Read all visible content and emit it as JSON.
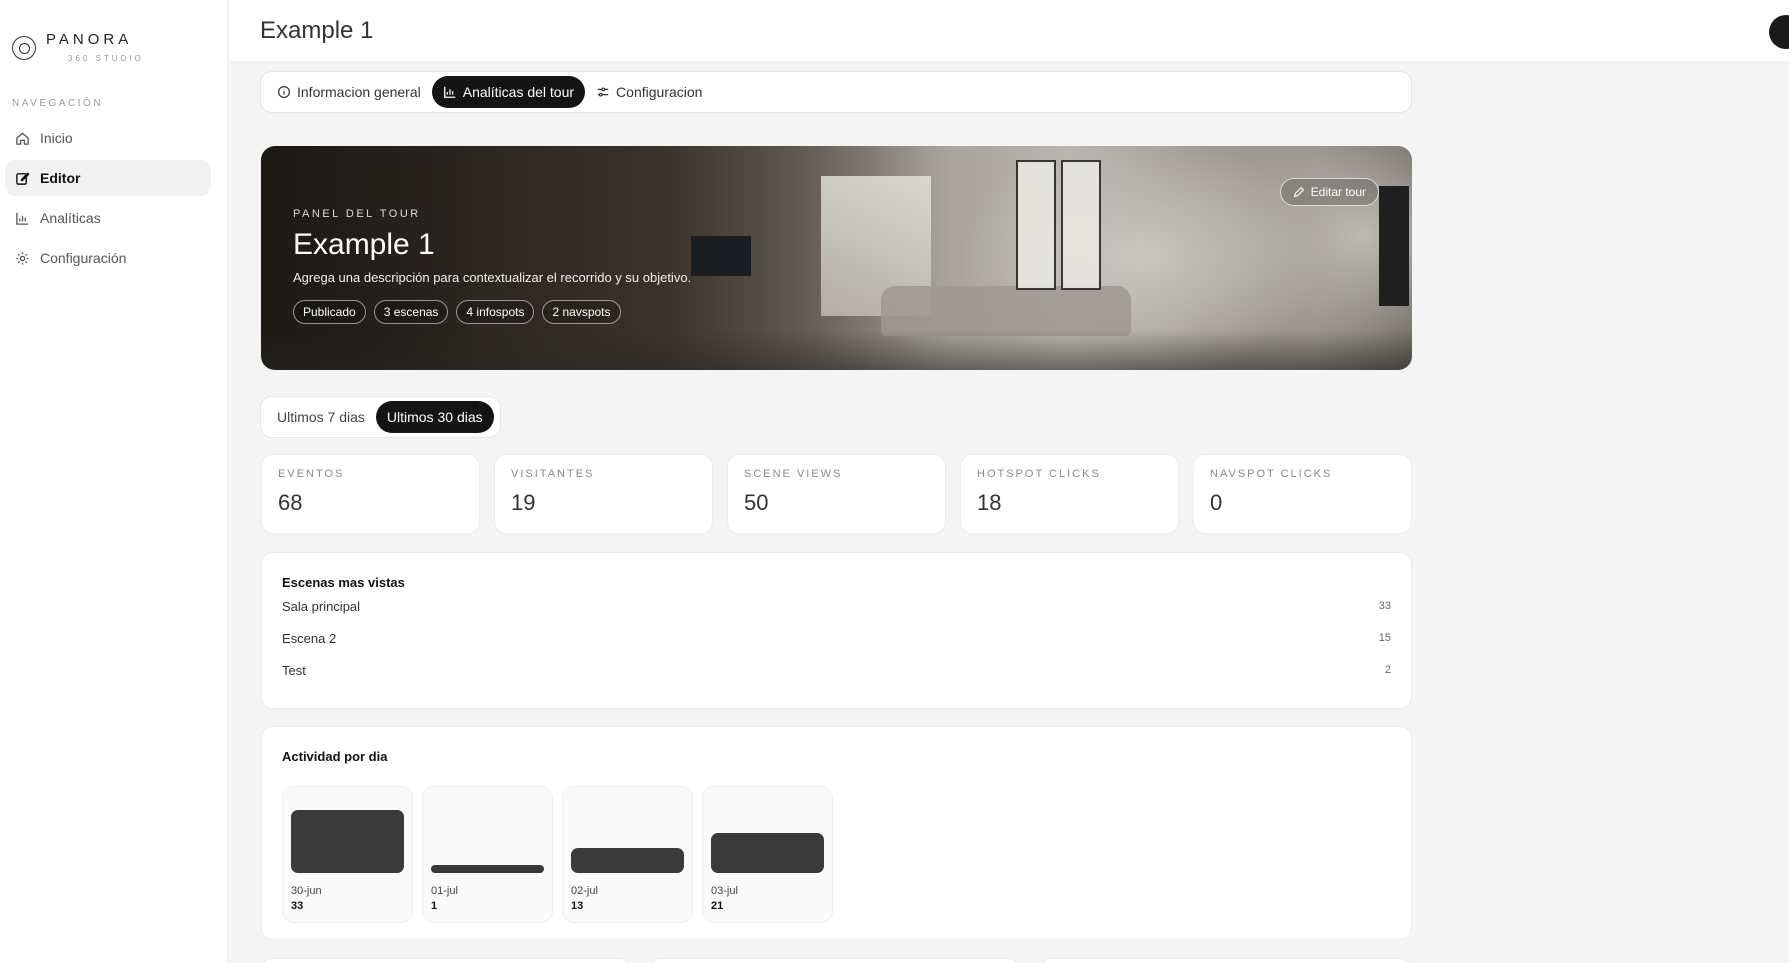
{
  "brand": {
    "name": "PANORA",
    "subtitle": "360 STUDIO"
  },
  "sidebar": {
    "heading": "NAVEGACIÓN",
    "items": [
      {
        "label": "Inicio",
        "icon": "home-icon",
        "active": false
      },
      {
        "label": "Editor",
        "icon": "edit-icon",
        "active": true
      },
      {
        "label": "Analíticas",
        "icon": "bar-chart-icon",
        "active": false
      },
      {
        "label": "Configuración",
        "icon": "gear-icon",
        "active": false
      }
    ]
  },
  "header": {
    "title": "Example 1"
  },
  "tabs": [
    {
      "label": "Informacion general",
      "icon": "info-icon",
      "active": false
    },
    {
      "label": "Analíticas del tour",
      "icon": "bar-chart-icon",
      "active": true
    },
    {
      "label": "Configuracion",
      "icon": "sliders-icon",
      "active": false
    }
  ],
  "hero": {
    "kicker": "PANEL DEL TOUR",
    "title": "Example 1",
    "description": "Agrega una descripción para contextualizar el recorrido y su objetivo.",
    "chips": [
      "Publicado",
      "3 escenas",
      "4 infospots",
      "2 navspots"
    ],
    "edit_label": "Editar tour"
  },
  "range": {
    "options": [
      "Ultimos 7 dias",
      "Ultimos 30 dias"
    ],
    "selected": "Ultimos 30 dias"
  },
  "stats": [
    {
      "label": "EVENTOS",
      "value": "68"
    },
    {
      "label": "VISITANTES",
      "value": "19"
    },
    {
      "label": "SCENE VIEWS",
      "value": "50"
    },
    {
      "label": "HOTSPOT CLICKS",
      "value": "18"
    },
    {
      "label": "NAVSPOT CLICKS",
      "value": "0"
    }
  ],
  "scenes": {
    "title": "Escenas mas vistas",
    "rows": [
      {
        "name": "Sala principal",
        "count": "33"
      },
      {
        "name": "Escena 2",
        "count": "15"
      },
      {
        "name": "Test",
        "count": "2"
      }
    ]
  },
  "activity": {
    "title": "Actividad por dia",
    "days": [
      {
        "date": "30-jun",
        "value": 33
      },
      {
        "date": "01-jul",
        "value": 1
      },
      {
        "date": "02-jul",
        "value": 13
      },
      {
        "date": "03-jul",
        "value": 21
      }
    ]
  },
  "colors": {
    "accent": "#141414",
    "bar": "#3a3a3a",
    "background": "#f4f4f4"
  }
}
